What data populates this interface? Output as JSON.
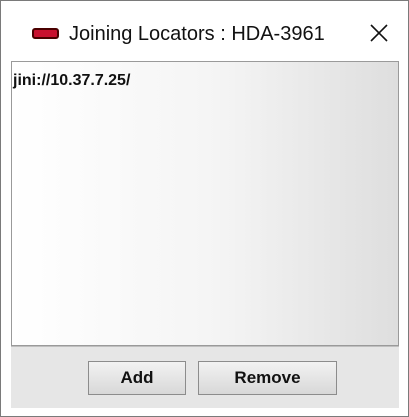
{
  "window": {
    "title": "Joining Locators : HDA-3961",
    "close_label": "×"
  },
  "locators": {
    "items": [
      "jini://10.37.7.25/"
    ]
  },
  "buttons": {
    "add_label": "Add",
    "remove_label": "Remove"
  },
  "colors": {
    "app_icon": "#c8102e",
    "button_bar": "#e6e6e6"
  },
  "icons": {
    "app": "app-red-indicator-icon",
    "close": "close-icon"
  }
}
